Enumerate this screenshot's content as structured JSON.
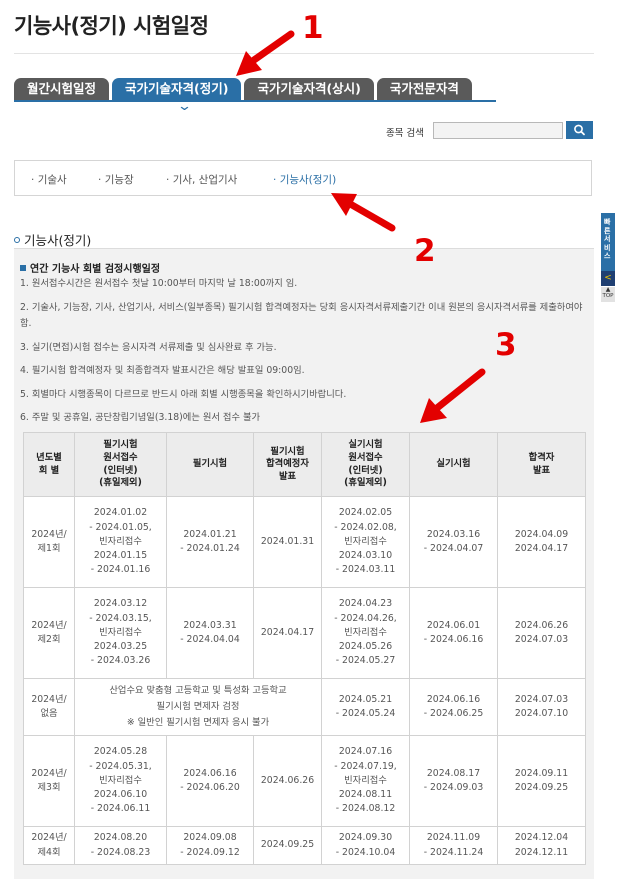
{
  "page_title": "기능사(정기) 시험일정",
  "tabs": [
    {
      "label": "월간시험일정",
      "active": false
    },
    {
      "label": "국가기술자격(정기)",
      "active": true
    },
    {
      "label": "국가기술자격(상시)",
      "active": false
    },
    {
      "label": "국가전문자격",
      "active": false
    }
  ],
  "search": {
    "label": "종목 검색",
    "value": "",
    "button_icon": "search-icon"
  },
  "subnav": [
    {
      "label": "기술사",
      "active": false
    },
    {
      "label": "기능장",
      "active": false
    },
    {
      "label": "기사, 산업기사",
      "active": false
    },
    {
      "label": "기능사(정기)",
      "active": true
    }
  ],
  "section_title": "기능사(정기)",
  "sub_heading": "연간 기능사 회별 검정시행일정",
  "notes": [
    "1. 원서접수시간은 원서접수 첫날 10:00부터 마지막 날 18:00까지 임.",
    "2. 기술사, 기능장, 기사, 산업기사, 서비스(일부종목) 필기시험 합격예정자는 당회 응시자격서류제출기간 이내 원본의 응시자격서류를 제출하여야 함.",
    "3. 실기(면접)시험 접수는 응시자격 서류제출 및 심사완료 후 가능.",
    "4. 필기시험 합격예정자 및 최종합격자 발표시간은 해당 발표일 09:00임.",
    "5. 회별마다 시행종목이 다르므로 반드시 아래 회별 시행종목을 확인하시기바랍니다.",
    "6. 주말 및 공휴일, 공단창립기념일(3.18)에는 원서 접수 불가"
  ],
  "table": {
    "headers": [
      [
        "년도별",
        "회 별"
      ],
      [
        "필기시험",
        "원서접수",
        "(인터넷)",
        "(휴일제외)"
      ],
      [
        "필기시험"
      ],
      [
        "필기시험",
        "합격예정자",
        "발표"
      ],
      [
        "실기시험",
        "원서접수",
        "(인터넷)",
        "(휴일제외)"
      ],
      [
        "실기시험"
      ],
      [
        "합격자",
        "발표"
      ]
    ],
    "rows": [
      {
        "round": [
          "2024년/",
          "제1회"
        ],
        "written_app": [
          "2024.01.02",
          "- 2024.01.05,",
          "빈자리접수",
          "2024.01.15",
          "- 2024.01.16"
        ],
        "written_exam": [
          "2024.01.21",
          "- 2024.01.24"
        ],
        "written_result": [
          "2024.01.31"
        ],
        "practical_app": [
          "2024.02.05",
          "- 2024.02.08,",
          "빈자리접수",
          "2024.03.10",
          "- 2024.03.11"
        ],
        "practical_exam": [
          "2024.03.16",
          "- 2024.04.07"
        ],
        "final_result": [
          "2024.04.09",
          "2024.04.17"
        ]
      },
      {
        "round": [
          "2024년/",
          "제2회"
        ],
        "written_app": [
          "2024.03.12",
          "- 2024.03.15,",
          "빈자리접수",
          "2024.03.25",
          "- 2024.03.26"
        ],
        "written_exam": [
          "2024.03.31",
          "- 2024.04.04"
        ],
        "written_result": [
          "2024.04.17"
        ],
        "practical_app": [
          "2024.04.23",
          "- 2024.04.26,",
          "빈자리접수",
          "2024.05.26",
          "- 2024.05.27"
        ],
        "practical_exam": [
          "2024.06.01",
          "- 2024.06.16"
        ],
        "final_result": [
          "2024.06.26",
          "2024.07.03"
        ]
      },
      {
        "round": [
          "2024년/",
          "없음"
        ],
        "merged_note": [
          "산업수요 맞춤형 고등학교 및 특성화 고등학교",
          "필기시험 면제자 검정",
          "※ 일반인 필기시험 면제자 응시 불가"
        ],
        "practical_app": [
          "2024.05.21",
          "- 2024.05.24"
        ],
        "practical_exam": [
          "2024.06.16",
          "- 2024.06.25"
        ],
        "final_result": [
          "2024.07.03",
          "2024.07.10"
        ]
      },
      {
        "round": [
          "2024년/",
          "제3회"
        ],
        "written_app": [
          "2024.05.28",
          "- 2024.05.31,",
          "빈자리접수",
          "2024.06.10",
          "- 2024.06.11"
        ],
        "written_exam": [
          "2024.06.16",
          "- 2024.06.20"
        ],
        "written_result": [
          "2024.06.26"
        ],
        "practical_app": [
          "2024.07.16",
          "- 2024.07.19,",
          "빈자리접수",
          "2024.08.11",
          "- 2024.08.12"
        ],
        "practical_exam": [
          "2024.08.17",
          "- 2024.09.03"
        ],
        "final_result": [
          "2024.09.11",
          "2024.09.25"
        ]
      },
      {
        "round": [
          "2024년/",
          "제4회"
        ],
        "written_app": [
          "2024.08.20",
          "- 2024.08.23"
        ],
        "written_exam": [
          "2024.09.08",
          "- 2024.09.12"
        ],
        "written_result": [
          "2024.09.25"
        ],
        "practical_app": [
          "2024.09.30",
          "- 2024.10.04"
        ],
        "practical_exam": [
          "2024.11.09",
          "- 2024.11.24"
        ],
        "final_result": [
          "2024.12.04",
          "2024.12.11"
        ]
      }
    ]
  },
  "side_panel": {
    "label": "빠른서비스",
    "arrow_icon": "chevron-left-icon",
    "top_label": "TOP"
  },
  "annotations": [
    {
      "number": "1",
      "color": "#e30000"
    },
    {
      "number": "2",
      "color": "#e30000"
    },
    {
      "number": "3",
      "color": "#e30000"
    }
  ],
  "colors": {
    "accent": "#2a6fa6",
    "tab_inactive": "#5a5a5a",
    "annotation": "#e30000"
  }
}
